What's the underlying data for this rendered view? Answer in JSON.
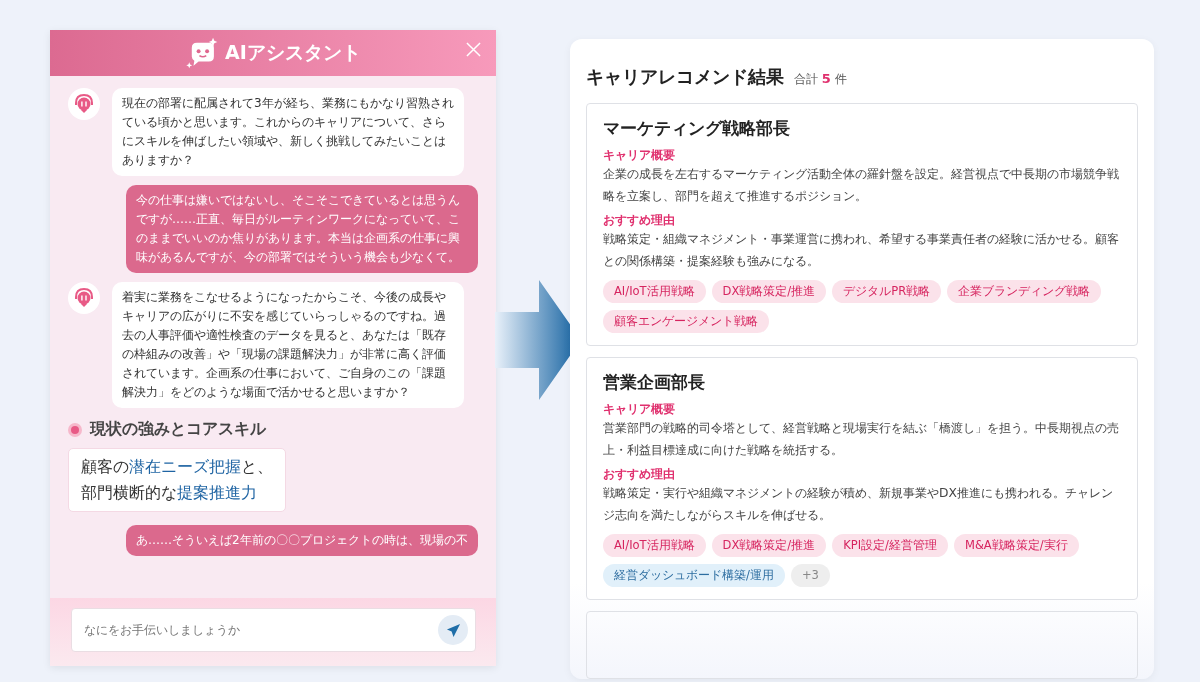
{
  "chat": {
    "title": "AIアシスタント",
    "messages": [
      {
        "kind": "ai",
        "text": "現在の部署に配属されて3年が経ち、業務にもかなり習熟されている頃かと思います。これからのキャリアについて、さらにスキルを伸ばしたい領域や、新しく挑戦してみたいことはありますか？"
      },
      {
        "kind": "user",
        "text": "今の仕事は嫌いではないし、そこそこできているとは思うんですが……正直、毎日がルーティンワークになっていて、このままでいいのか焦りがあります。本当は企画系の仕事に興味があるんですが、今の部署ではそういう機会も少なくて。"
      },
      {
        "kind": "ai",
        "text": "着実に業務をこなせるようになったからこそ、今後の成長やキャリアの広がりに不安を感じていらっしゃるのですね。過去の人事評価や適性検査のデータを見ると、あなたは「既存の枠組みの改善」や「現場の課題解決力」が非常に高く評価されています。企画系の仕事において、ご自身のこの「課題解決力」をどのような場面で活かせると思いますか？"
      },
      {
        "kind": "strength",
        "heading": "現状の強みとコアスキル",
        "lines": [
          [
            {
              "text": "顧客の",
              "highlight": false
            },
            {
              "text": "潜在ニーズ把握",
              "highlight": true
            },
            {
              "text": "と、",
              "highlight": false
            }
          ],
          [
            {
              "text": "部門横断的な",
              "highlight": false
            },
            {
              "text": "提案推進力",
              "highlight": true
            }
          ]
        ]
      },
      {
        "kind": "user",
        "text": "あ……そういえば2年前の〇〇プロジェクトの時は、現場の不"
      }
    ],
    "input": {
      "placeholder": "なにをお手伝いしましょうか"
    }
  },
  "results": {
    "title": "キャリアレコメンド結果",
    "total_label": "合計",
    "count": "5",
    "unit": "件",
    "cards": [
      {
        "title": "マーケティング戦略部長",
        "overview_label": "キャリア概要",
        "overview": "企業の成長を左右するマーケティング活動全体の羅針盤を設定。経営視点で中長期の市場競争戦略を立案し、部門を超えて推進するポジション。",
        "reason_label": "おすすめ理由",
        "reason": "戦略策定・組織マネジメント・事業運営に携われ、希望する事業責任者の経験に活かせる。顧客との関係構築・提案経験も強みになる。",
        "tags": [
          {
            "text": "AI/IoT活用戦略",
            "kind": "skill"
          },
          {
            "text": "DX戦略策定/推進",
            "kind": "skill"
          },
          {
            "text": "デジタルPR戦略",
            "kind": "skill"
          },
          {
            "text": "企業ブランディング戦略",
            "kind": "skill"
          },
          {
            "text": "顧客エンゲージメント戦略",
            "kind": "skill"
          }
        ]
      },
      {
        "title": "営業企画部長",
        "overview_label": "キャリア概要",
        "overview": "営業部門の戦略的司令塔として、経営戦略と現場実行を結ぶ「橋渡し」を担う。中長期視点の売上・利益目標達成に向けた戦略を統括する。",
        "reason_label": "おすすめ理由",
        "reason": "戦略策定・実行や組織マネジメントの経験が積め、新規事業やDX推進にも携われる。チャレンジ志向を満たしながらスキルを伸ばせる。",
        "tags": [
          {
            "text": "AI/IoT活用戦略",
            "kind": "skill"
          },
          {
            "text": "DX戦略策定/推進",
            "kind": "skill"
          },
          {
            "text": "KPI設定/経営管理",
            "kind": "skill"
          },
          {
            "text": "M&A戦略策定/実行",
            "kind": "skill"
          },
          {
            "text": "経営ダッシュボード構築/運用",
            "kind": "other"
          },
          {
            "text": "+3",
            "kind": "more"
          }
        ]
      },
      {
        "kind": "placeholder_card"
      }
    ]
  }
}
